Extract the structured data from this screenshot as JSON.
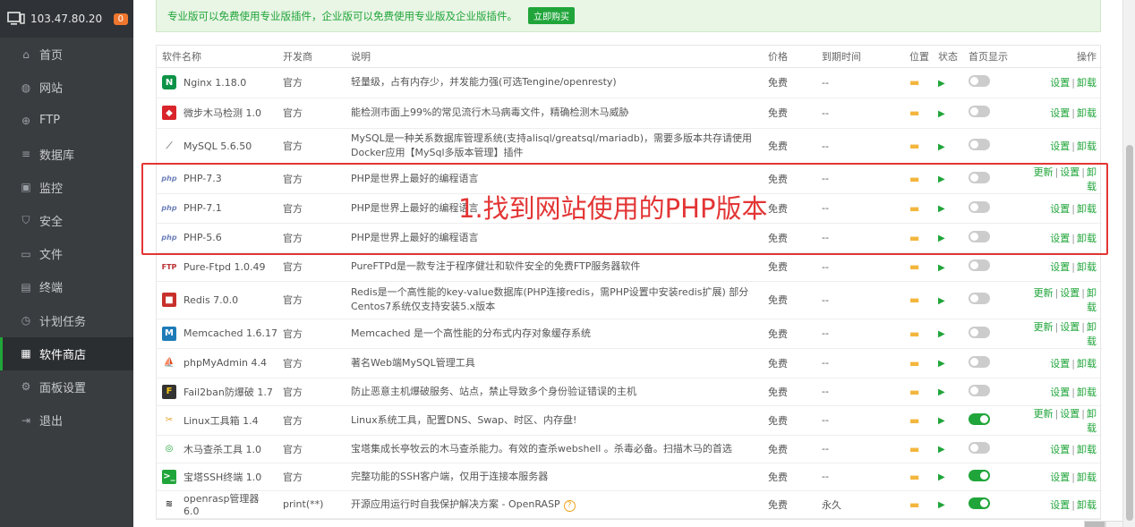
{
  "sidebar": {
    "ip": "103.47.80.20",
    "badge": "0",
    "items": [
      {
        "label": "首页",
        "icon": "home-icon"
      },
      {
        "label": "网站",
        "icon": "globe-icon"
      },
      {
        "label": "FTP",
        "icon": "ftp-icon"
      },
      {
        "label": "数据库",
        "icon": "database-icon"
      },
      {
        "label": "监控",
        "icon": "monitor-icon"
      },
      {
        "label": "安全",
        "icon": "shield-icon"
      },
      {
        "label": "文件",
        "icon": "folder-icon"
      },
      {
        "label": "终端",
        "icon": "terminal-icon"
      },
      {
        "label": "计划任务",
        "icon": "clock-icon"
      },
      {
        "label": "软件商店",
        "icon": "grid-icon"
      },
      {
        "label": "面板设置",
        "icon": "gear-icon"
      },
      {
        "label": "退出",
        "icon": "logout-icon"
      }
    ]
  },
  "notice": {
    "text": "专业版可以免费使用专业版插件，企业版可以免费使用专业版及企业版插件。",
    "buy": "立即购买"
  },
  "table": {
    "headers": [
      "软件名称",
      "开发商",
      "说明",
      "价格",
      "到期时间",
      "位置",
      "状态",
      "首页显示",
      "操作"
    ],
    "rows": [
      {
        "name": "Nginx 1.18.0",
        "vendor": "官方",
        "desc": "轻量级，占有内存少，并发能力强(可选Tengine/openresty)",
        "price": "免费",
        "expire": "--",
        "home": false,
        "ops": [
          "设置",
          "卸载"
        ]
      },
      {
        "name": "微步木马检测 1.0",
        "vendor": "官方",
        "desc": "能检测市面上99%的常见流行木马病毒文件，精确检测木马威胁",
        "price": "免费",
        "expire": "--",
        "home": false,
        "ops": [
          "设置",
          "卸载"
        ]
      },
      {
        "name": "MySQL 5.6.50",
        "vendor": "官方",
        "desc": "MySQL是一种关系数据库管理系统(支持alisql/greatsql/mariadb)，需要多版本共存请使用Docker应用【MySql多版本管理】插件",
        "price": "免费",
        "expire": "--",
        "home": false,
        "ops": [
          "设置",
          "卸载"
        ]
      },
      {
        "name": "PHP-7.3",
        "vendor": "官方",
        "desc": "PHP是世界上最好的编程语言",
        "price": "免费",
        "expire": "--",
        "home": false,
        "ops": [
          "更新",
          "设置",
          "卸载"
        ]
      },
      {
        "name": "PHP-7.1",
        "vendor": "官方",
        "desc": "PHP是世界上最好的编程语言",
        "price": "免费",
        "expire": "--",
        "home": false,
        "ops": [
          "设置",
          "卸载"
        ]
      },
      {
        "name": "PHP-5.6",
        "vendor": "官方",
        "desc": "PHP是世界上最好的编程语言",
        "price": "免费",
        "expire": "--",
        "home": false,
        "ops": [
          "设置",
          "卸载"
        ]
      },
      {
        "name": "Pure-Ftpd 1.0.49",
        "vendor": "官方",
        "desc": "PureFTPd是一款专注于程序健壮和软件安全的免费FTP服务器软件",
        "price": "免费",
        "expire": "--",
        "home": false,
        "ops": [
          "设置",
          "卸载"
        ]
      },
      {
        "name": "Redis 7.0.0",
        "vendor": "官方",
        "desc": "Redis是一个高性能的key-value数据库(PHP连接redis，需PHP设置中安装redis扩展) 部分Centos7系统仅支持安装5.x版本",
        "price": "免费",
        "expire": "--",
        "home": false,
        "ops": [
          "更新",
          "设置",
          "卸载"
        ]
      },
      {
        "name": "Memcached 1.6.17",
        "vendor": "官方",
        "desc": "Memcached 是一个高性能的分布式内存对象缓存系统",
        "price": "免费",
        "expire": "--",
        "home": false,
        "ops": [
          "更新",
          "设置",
          "卸载"
        ]
      },
      {
        "name": "phpMyAdmin 4.4",
        "vendor": "官方",
        "desc": "著名Web端MySQL管理工具",
        "price": "免费",
        "expire": "--",
        "home": false,
        "ops": [
          "设置",
          "卸载"
        ]
      },
      {
        "name": "Fail2ban防爆破 1.7",
        "vendor": "官方",
        "desc": "防止恶意主机爆破服务、站点，禁止导致多个身份验证错误的主机",
        "price": "免费",
        "expire": "--",
        "home": false,
        "ops": [
          "设置",
          "卸载"
        ]
      },
      {
        "name": "Linux工具箱 1.4",
        "vendor": "官方",
        "desc": "Linux系统工具，配置DNS、Swap、时区、内存盘!",
        "price": "免费",
        "expire": "--",
        "home": true,
        "ops": [
          "更新",
          "设置",
          "卸载"
        ]
      },
      {
        "name": "木马查杀工具 1.0",
        "vendor": "官方",
        "desc": "宝塔集成长亭牧云的木马查杀能力。有效的查杀webshell 。杀毒必备。扫描木马的首选",
        "price": "免费",
        "expire": "--",
        "home": false,
        "ops": [
          "设置",
          "卸载"
        ]
      },
      {
        "name": "宝塔SSH终端 1.0",
        "vendor": "官方",
        "desc": "完整功能的SSH客户端，仅用于连接本服务器",
        "price": "免费",
        "expire": "--",
        "home": true,
        "ops": [
          "设置",
          "卸载"
        ]
      },
      {
        "name": "openrasp管理器 6.0",
        "vendor": "print(**)",
        "desc": "开源应用运行时自我保护解决方案 - OpenRASP",
        "price": "免费",
        "expire": "永久",
        "home": true,
        "ops": [
          "设置",
          "卸载"
        ]
      }
    ]
  },
  "annotation": {
    "text": "1.找到网站使用的PHP版本"
  },
  "colors": {
    "accent": "#20a53a",
    "annotation": "#e33535",
    "sidebar_bg": "#3a3d40"
  }
}
